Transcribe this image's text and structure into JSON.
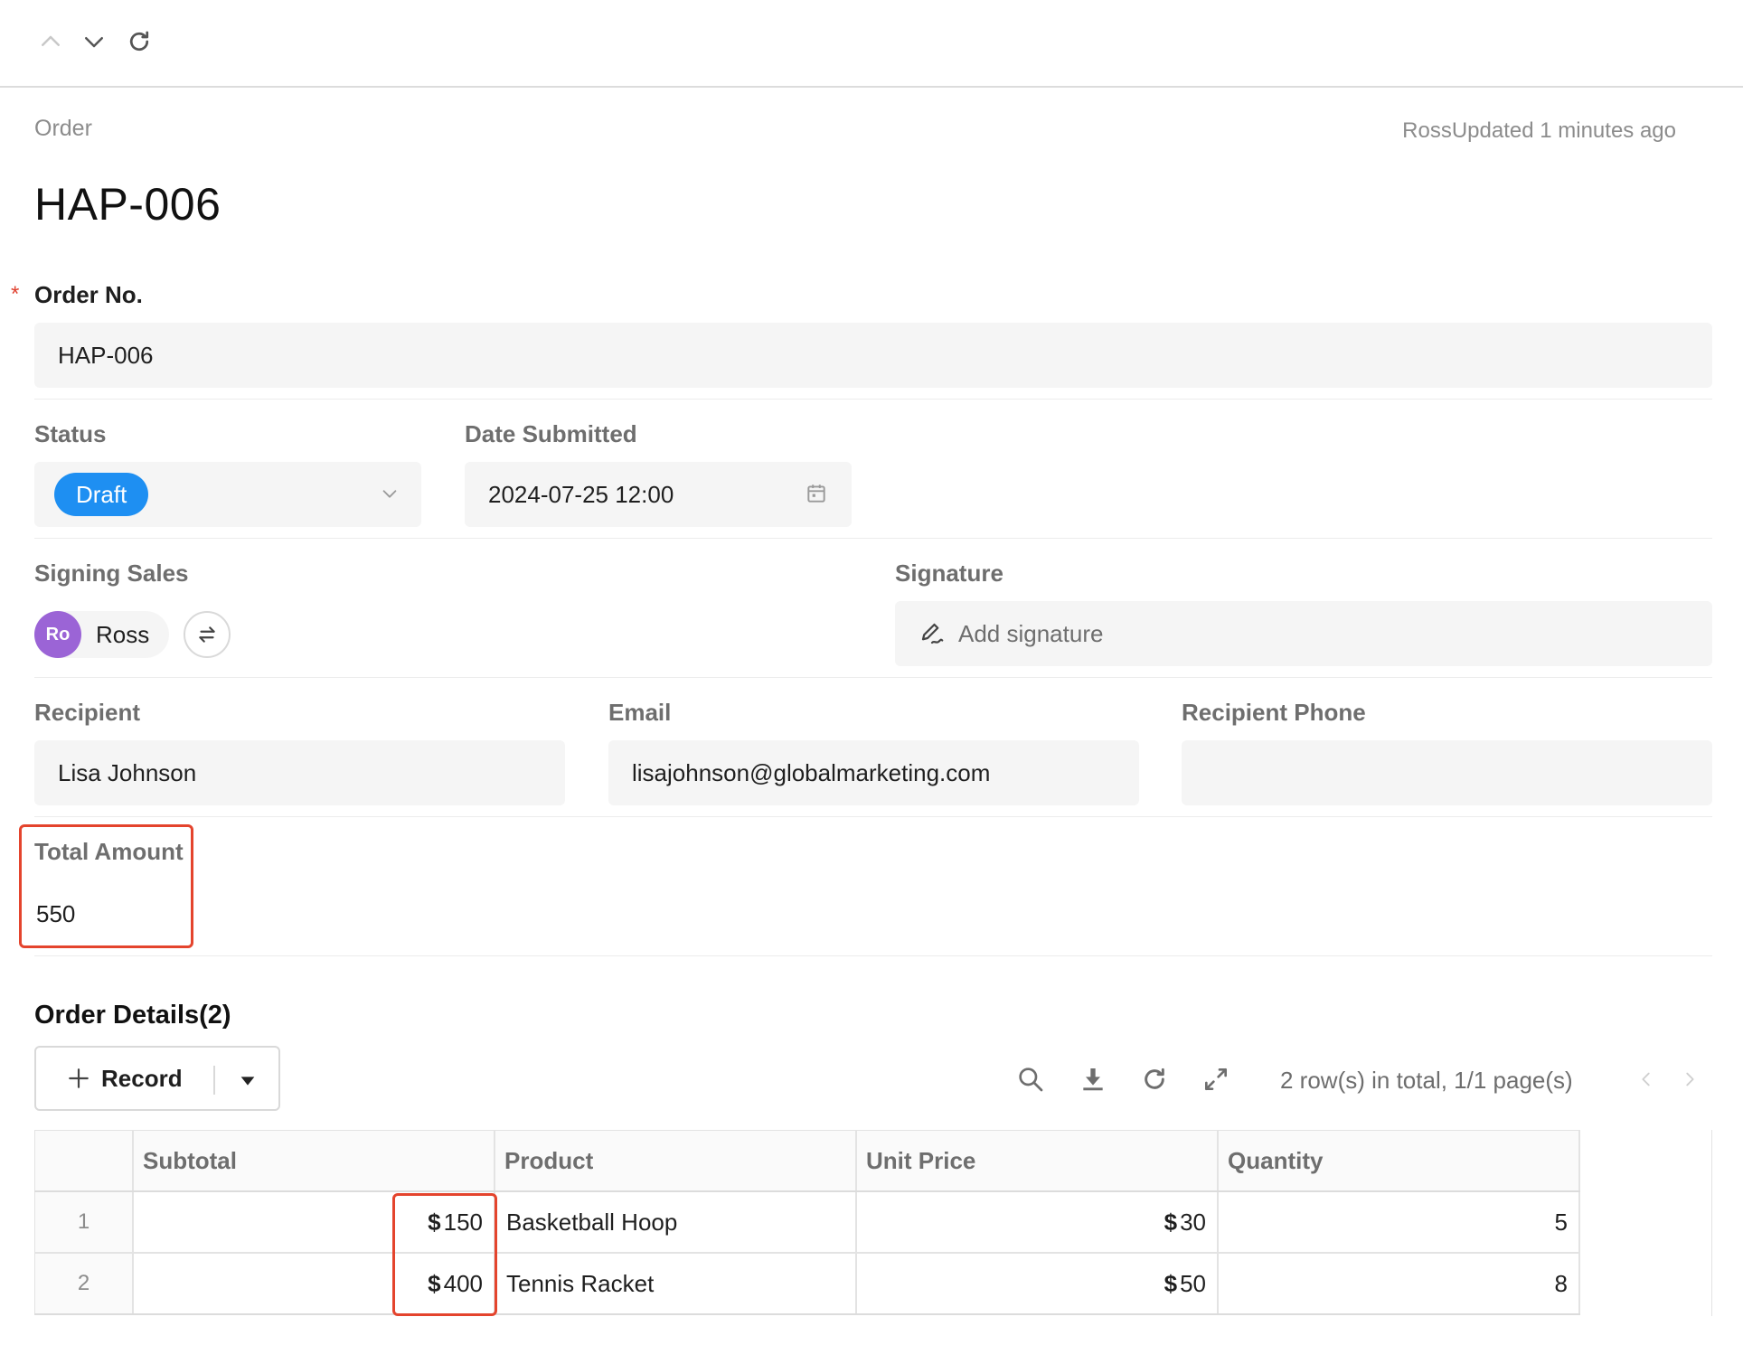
{
  "header": {
    "record_type": "Order",
    "updated_by": "Ross",
    "updated_text": "Updated 1 minutes ago",
    "title": "HAP-006"
  },
  "form": {
    "order_no": {
      "label": "Order No.",
      "required_mark": "*",
      "value": "HAP-006"
    },
    "status": {
      "label": "Status",
      "value": "Draft",
      "badge_color": "#1e8ff2"
    },
    "date_submitted": {
      "label": "Date Submitted",
      "value": "2024-07-25 12:00"
    },
    "signing_sales": {
      "label": "Signing Sales",
      "avatar_initials": "Ro",
      "avatar_color": "#9b64d6",
      "name": "Ross"
    },
    "signature": {
      "label": "Signature",
      "placeholder": "Add signature"
    },
    "recipient": {
      "label": "Recipient",
      "value": "Lisa Johnson"
    },
    "email": {
      "label": "Email",
      "value": "lisajohnson@globalmarketing.com"
    },
    "recipient_phone": {
      "label": "Recipient Phone",
      "value": ""
    },
    "total_amount": {
      "label": "Total Amount",
      "value": "550"
    }
  },
  "order_details": {
    "title": "Order Details(2)",
    "record_button_label": "Record",
    "pagination_text": "2 row(s) in total, 1/1 page(s)",
    "columns": [
      "Subtotal",
      "Product",
      "Unit Price",
      "Quantity"
    ],
    "rows": [
      {
        "index": "1",
        "subtotal_symbol": "$",
        "subtotal": "150",
        "product": "Basketball Hoop",
        "unit_price_symbol": "$",
        "unit_price": "30",
        "quantity": "5"
      },
      {
        "index": "2",
        "subtotal_symbol": "$",
        "subtotal": "400",
        "product": "Tennis Racket",
        "unit_price_symbol": "$",
        "unit_price": "50",
        "quantity": "8"
      }
    ]
  },
  "icons": {
    "nav": [
      "chevron-up-icon",
      "chevron-down-icon",
      "refresh-icon"
    ],
    "toolbar": [
      "search-icon",
      "download-icon",
      "refresh-icon",
      "expand-icon"
    ],
    "pager": [
      "prev-page-icon",
      "next-page-icon"
    ]
  },
  "colors": {
    "highlight_border": "#e4442d",
    "field_bg": "#f5f5f5"
  }
}
